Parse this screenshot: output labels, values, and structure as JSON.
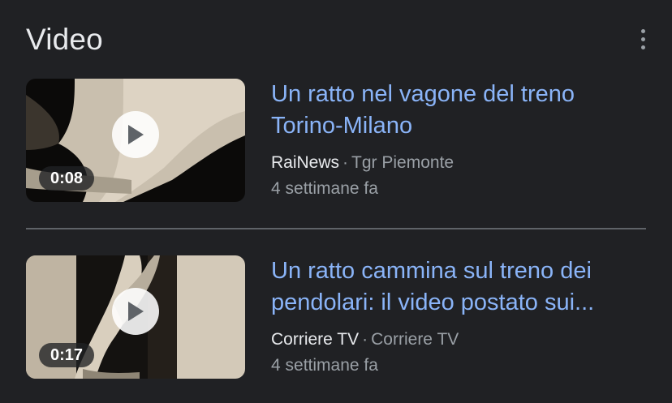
{
  "section": {
    "title": "Video"
  },
  "videos": [
    {
      "title_line1": "Un ratto nel vagone del treno",
      "title_line2": "Torino-Milano",
      "publisher": "RaiNews",
      "separator": "·",
      "channel": "Tgr Piemonte",
      "age": "4 settimane fa",
      "duration": "0:08"
    },
    {
      "title_line1": "Un ratto cammina sul treno dei",
      "title_line2": "pendolari: il video postato sui...",
      "publisher": "Corriere TV",
      "separator": "·",
      "channel": "Corriere TV",
      "age": "4 settimane fa",
      "duration": "0:17"
    }
  ],
  "icons": {
    "more": "more-vertical-icon",
    "play": "play-icon"
  },
  "colors": {
    "background": "#202124",
    "link": "#8ab4f8",
    "text": "#e8eaed",
    "secondary": "#9aa0a6"
  }
}
